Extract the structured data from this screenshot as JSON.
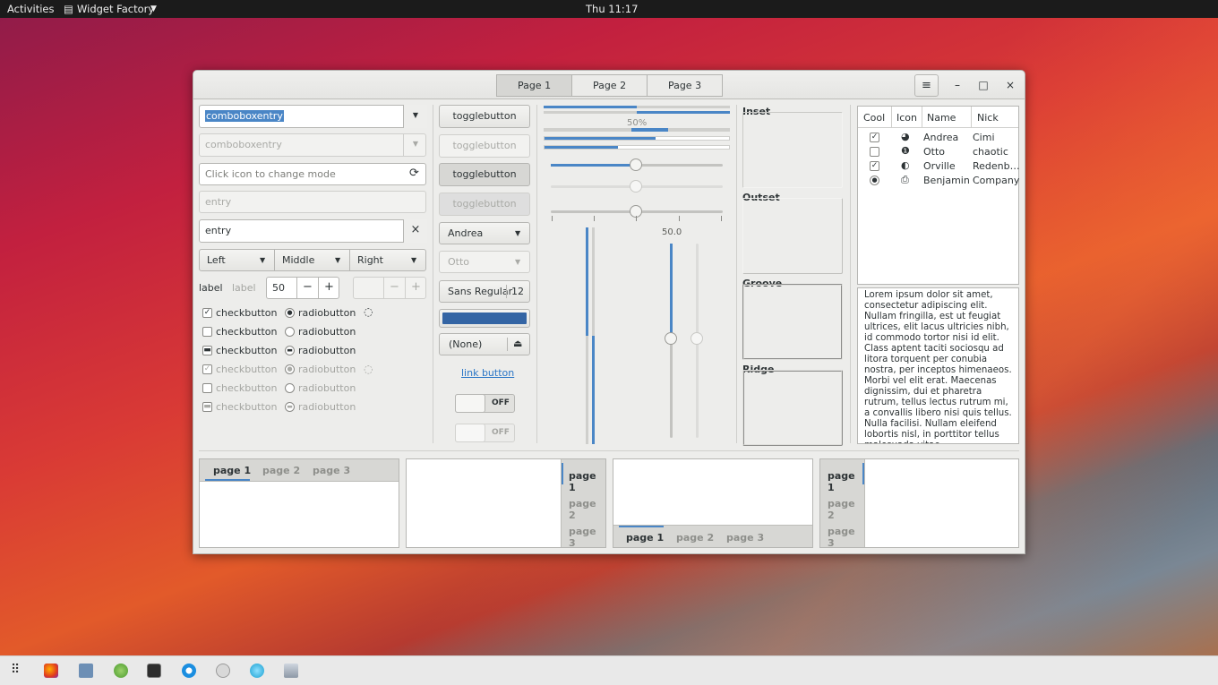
{
  "topbar": {
    "activities": "Activities",
    "app": "Widget Factory",
    "clock": "Thu 11:17"
  },
  "window": {
    "switcher": [
      "Page 1",
      "Page 2",
      "Page 3"
    ],
    "menu_icon": "hamburger-icon",
    "min": "–",
    "max": "□",
    "close": "×"
  },
  "left": {
    "combo1": "comboboxentry",
    "combo2": "comboboxentry",
    "iconentry_placeholder": "Click icon to change mode",
    "entry_dim": "entry",
    "entry": "entry",
    "seg": [
      "Left",
      "Middle",
      "Right"
    ],
    "label1": "label",
    "label2": "label",
    "spin_value": "50",
    "spin_minus": "−",
    "spin_plus": "+",
    "check": "checkbutton",
    "radio": "radiobutton"
  },
  "mid": {
    "toggle": "togglebutton",
    "combo_andrea": "Andrea",
    "combo_otto": "Otto",
    "font_name": "Sans Regular",
    "font_size": "12",
    "file": "(None)",
    "link": "link button",
    "switch1": "OFF",
    "switch2": "OFF"
  },
  "sliders": {
    "progress_label": "50%",
    "scale_value": "50.0",
    "progress": 0.5
  },
  "frames": {
    "inset": "Inset",
    "outset": "Outset",
    "groove": "Groove",
    "ridge": "Ridge"
  },
  "tree": {
    "headers": [
      "Cool",
      "Icon",
      "Name",
      "Nick"
    ],
    "rows": [
      {
        "name": "Andrea",
        "nick": "Cimi"
      },
      {
        "name": "Otto",
        "nick": "chaotic"
      },
      {
        "name": "Orville",
        "nick": "Redenb…"
      },
      {
        "name": "Benjamin",
        "nick": "Company"
      }
    ]
  },
  "textview": "Lorem ipsum dolor sit amet, consectetur adipiscing elit.\nNullam fringilla, est ut feugiat ultrices, elit lacus ultricies nibh, id commodo tortor nisi id elit.\nClass aptent taciti sociosqu ad litora torquent per conubia nostra, per inceptos himenaeos.\nMorbi vel elit erat. Maecenas dignissim, dui et pharetra rutrum, tellus lectus rutrum mi, a convallis libero nisi quis tellus.\nNulla facilisi. Nullam eleifend lobortis nisl, in porttitor tellus malesuada vitae.",
  "notebooks": {
    "tabs": [
      "page 1",
      "page 2",
      "page 3"
    ]
  }
}
